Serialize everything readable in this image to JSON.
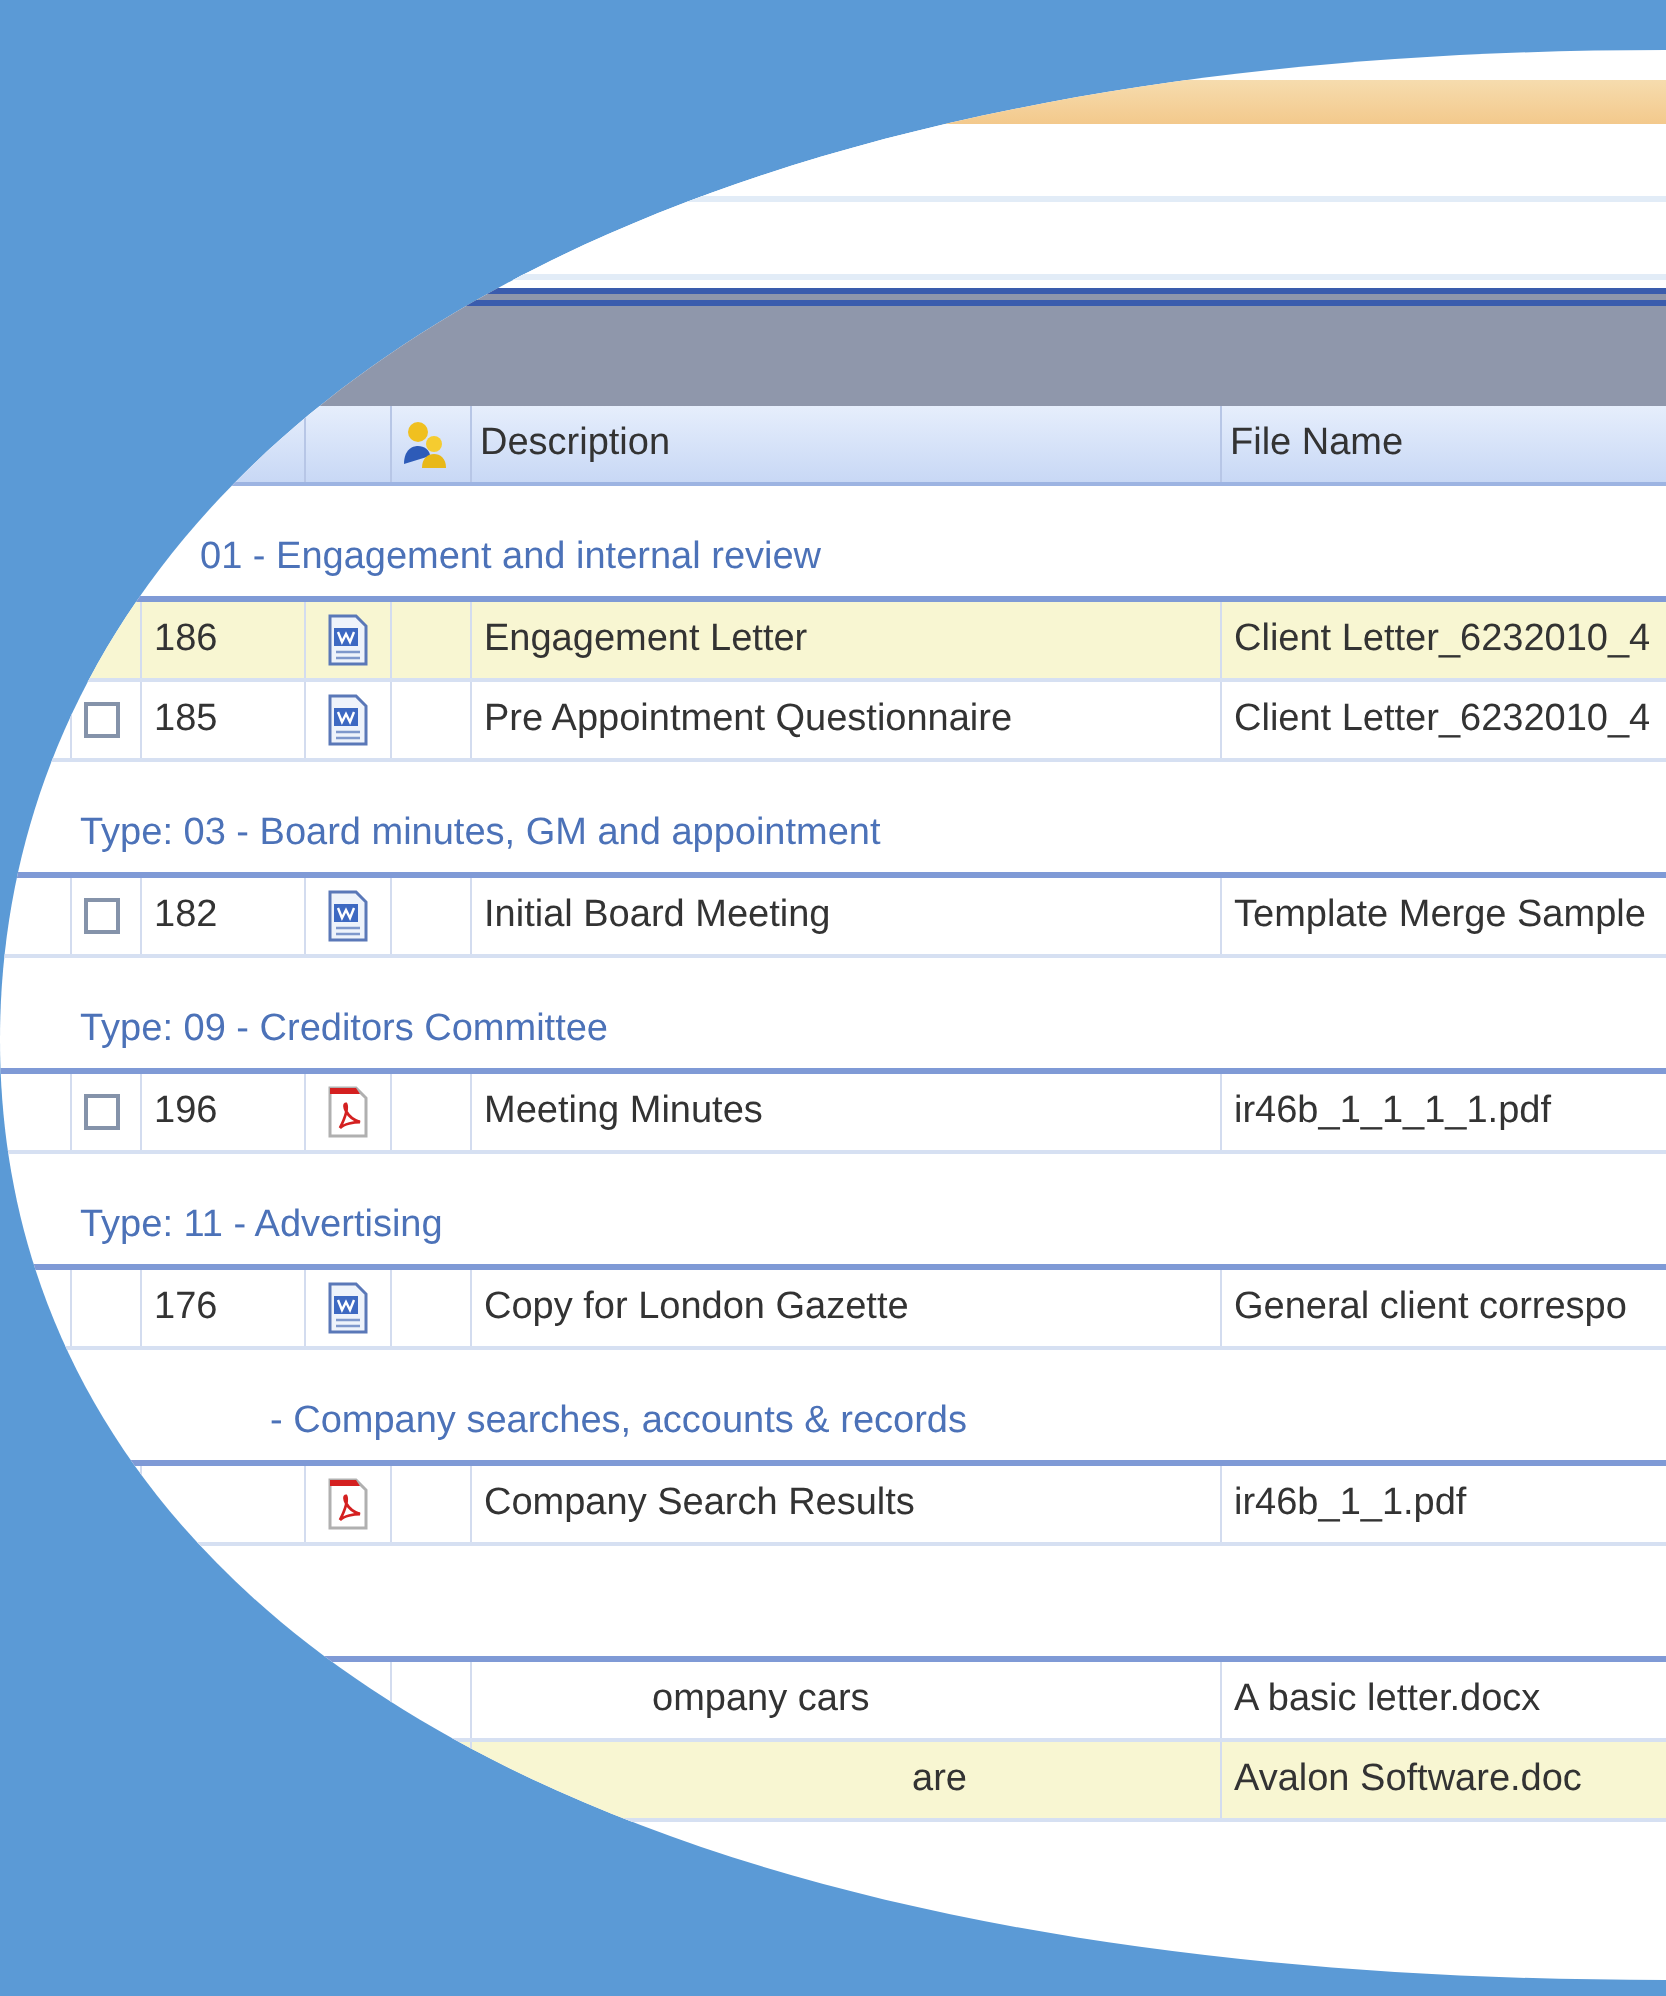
{
  "header": {
    "description": "Description",
    "file_name": "File Name"
  },
  "groups": [
    {
      "title": "01 - Engagement and internal review",
      "rows": [
        {
          "id": "186",
          "kind": "word",
          "description": "Engagement Letter",
          "file_name": "Client Letter_6232010_4",
          "selected": true
        },
        {
          "checked": false,
          "id": "185",
          "kind": "word",
          "description": "Pre Appointment Questionnaire",
          "file_name": "Client Letter_6232010_4",
          "selected": false
        }
      ]
    },
    {
      "title": "Type: 03 - Board minutes, GM and appointment",
      "rows": [
        {
          "checked": false,
          "id": "182",
          "kind": "word",
          "description": "Initial Board Meeting",
          "file_name": "Template Merge Sample",
          "selected": false
        }
      ]
    },
    {
      "title": "Type: 09 - Creditors Committee",
      "rows": [
        {
          "checked": false,
          "id": "196",
          "kind": "pdf",
          "description": "Meeting Minutes",
          "file_name": "ir46b_1_1_1_1.pdf",
          "selected": false
        }
      ]
    },
    {
      "title": "Type: 11 - Advertising",
      "rows": [
        {
          "id": "176",
          "kind": "word",
          "description": "Copy for London Gazette",
          "file_name": "General client correspo",
          "selected": false
        }
      ]
    },
    {
      "title": "- Company searches, accounts & records",
      "rows": [
        {
          "kind": "pdf",
          "description": "Company Search Results",
          "file_name": "ir46b_1_1.pdf",
          "selected": false
        }
      ]
    },
    {
      "rows": [
        {
          "description": "ompany cars",
          "file_name": "A basic letter.docx",
          "selected": false
        },
        {
          "description": "are",
          "file_name": "Avalon Software.doc",
          "selected": true
        }
      ]
    }
  ]
}
